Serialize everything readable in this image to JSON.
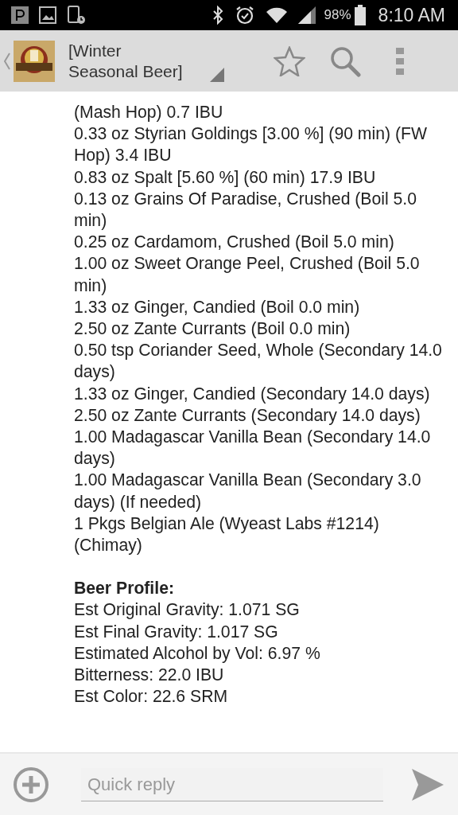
{
  "status_bar": {
    "battery": "98%",
    "time": "8:10 AM"
  },
  "app_bar": {
    "title": "[Winter Seasonal Beer]"
  },
  "ingredients": [
    "(Mash Hop) 0.7 IBU",
    "0.33 oz Styrian Goldings [3.00 %] (90 min) (FW Hop) 3.4 IBU",
    "0.83 oz Spalt [5.60 %] (60 min) 17.9 IBU",
    "0.13 oz Grains Of Paradise, Crushed (Boil 5.0 min)",
    "0.25 oz Cardamom, Crushed (Boil 5.0 min)",
    "1.00 oz Sweet Orange Peel, Crushed (Boil 5.0 min)",
    "1.33 oz Ginger, Candied (Boil 0.0 min)",
    "2.50 oz Zante Currants (Boil 0.0 min)",
    "0.50 tsp Coriander Seed, Whole (Secondary 14.0 days)",
    "1.33 oz Ginger, Candied (Secondary 14.0 days)",
    "2.50 oz Zante Currants (Secondary 14.0 days)",
    "1.00 Madagascar Vanilla Bean (Secondary 14.0 days)",
    "1.00 Madagascar Vanilla Bean (Secondary 3.0 days) (If needed)",
    "1 Pkgs Belgian Ale (Wyeast Labs #1214) (Chimay)"
  ],
  "profile": {
    "heading": "Beer Profile:",
    "lines": [
      "Est Original Gravity: 1.071 SG",
      "Est Final Gravity: 1.017 SG",
      "Estimated Alcohol by Vol: 6.97 %",
      "Bitterness: 22.0 IBU",
      "Est Color: 22.6 SRM"
    ]
  },
  "reply": {
    "placeholder": "Quick reply"
  }
}
